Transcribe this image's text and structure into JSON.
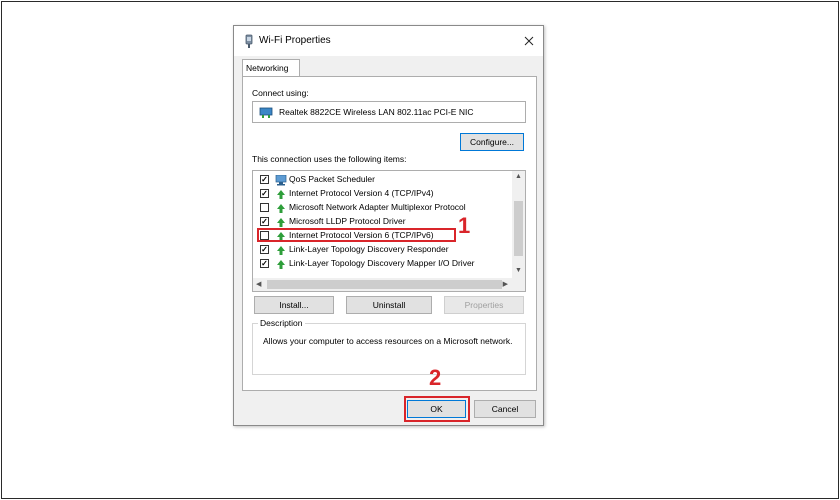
{
  "window": {
    "title": "Wi-Fi Properties"
  },
  "tabs": [
    {
      "label": "Networking"
    }
  ],
  "connect_using": {
    "label": "Connect using:",
    "adapter_name": "Realtek 8822CE Wireless LAN 802.11ac PCI-E NIC",
    "configure_label": "Configure..."
  },
  "items_section": {
    "label": "This connection uses the following items:",
    "items": [
      {
        "label": "QoS Packet Scheduler",
        "checked": true,
        "icon": "network-monitor-icon"
      },
      {
        "label": "Internet Protocol Version 4 (TCP/IPv4)",
        "checked": true,
        "icon": "protocol-icon"
      },
      {
        "label": "Microsoft Network Adapter Multiplexor Protocol",
        "checked": false,
        "icon": "protocol-icon"
      },
      {
        "label": "Microsoft LLDP Protocol Driver",
        "checked": true,
        "icon": "protocol-icon"
      },
      {
        "label": "Internet Protocol Version 6 (TCP/IPv6)",
        "checked": false,
        "icon": "protocol-icon"
      },
      {
        "label": "Link-Layer Topology Discovery Responder",
        "checked": true,
        "icon": "protocol-icon"
      },
      {
        "label": "Link-Layer Topology Discovery Mapper I/O Driver",
        "checked": true,
        "icon": "protocol-icon"
      }
    ]
  },
  "item_buttons": {
    "install": "Install...",
    "uninstall": "Uninstall",
    "properties": "Properties"
  },
  "description": {
    "legend": "Description",
    "text": "Allows your computer to access resources on a Microsoft network."
  },
  "footer": {
    "ok": "OK",
    "cancel": "Cancel"
  },
  "annotations": {
    "step1": "1",
    "step2": "2"
  },
  "colors": {
    "annotation": "#d9252a",
    "accent": "#0078d7",
    "protocol_icon": "#2e9e3a"
  }
}
